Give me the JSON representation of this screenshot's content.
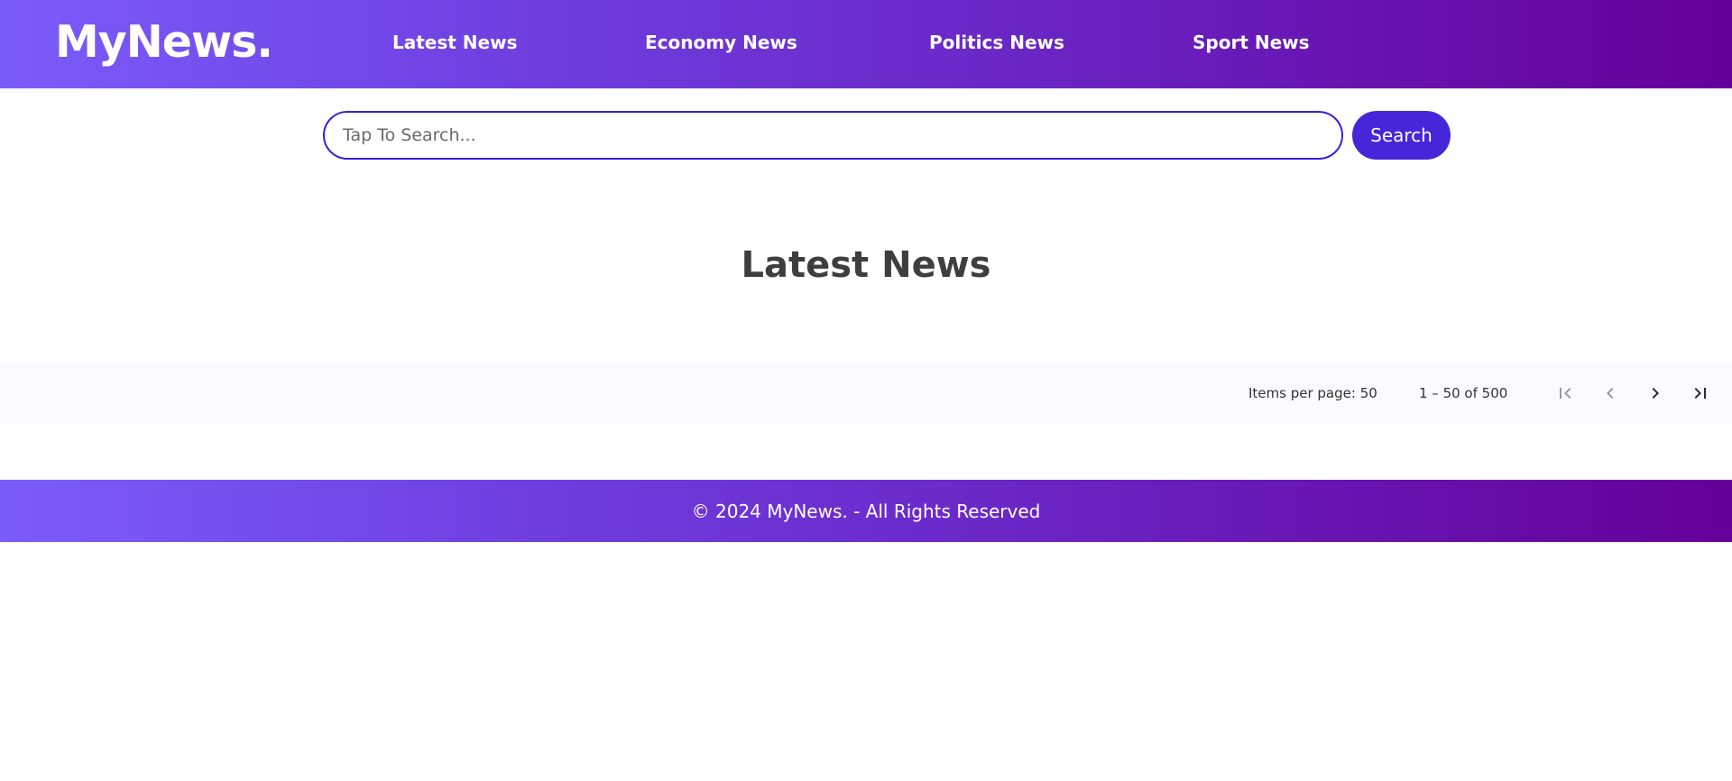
{
  "header": {
    "logo": "MyNews.",
    "nav": [
      {
        "label": "Latest News"
      },
      {
        "label": "Economy News"
      },
      {
        "label": "Politics News"
      },
      {
        "label": "Sport News"
      }
    ]
  },
  "search": {
    "placeholder": "Tap To Search...",
    "value": "",
    "button_label": "Search"
  },
  "main": {
    "title": "Latest News"
  },
  "paginator": {
    "items_per_page_label": "Items per page: 50",
    "range_label": "1 – 50 of 500",
    "first_icon": "first-page-icon",
    "prev_icon": "chevron-left-icon",
    "next_icon": "chevron-right-icon",
    "last_icon": "last-page-icon"
  },
  "footer": {
    "text": "© 2024 MyNews. - All Rights Reserved"
  },
  "colors": {
    "gradient_start": "#7a5cfa",
    "gradient_end": "#650099",
    "accent": "#4527d9",
    "title_text": "#3e3e3e"
  }
}
